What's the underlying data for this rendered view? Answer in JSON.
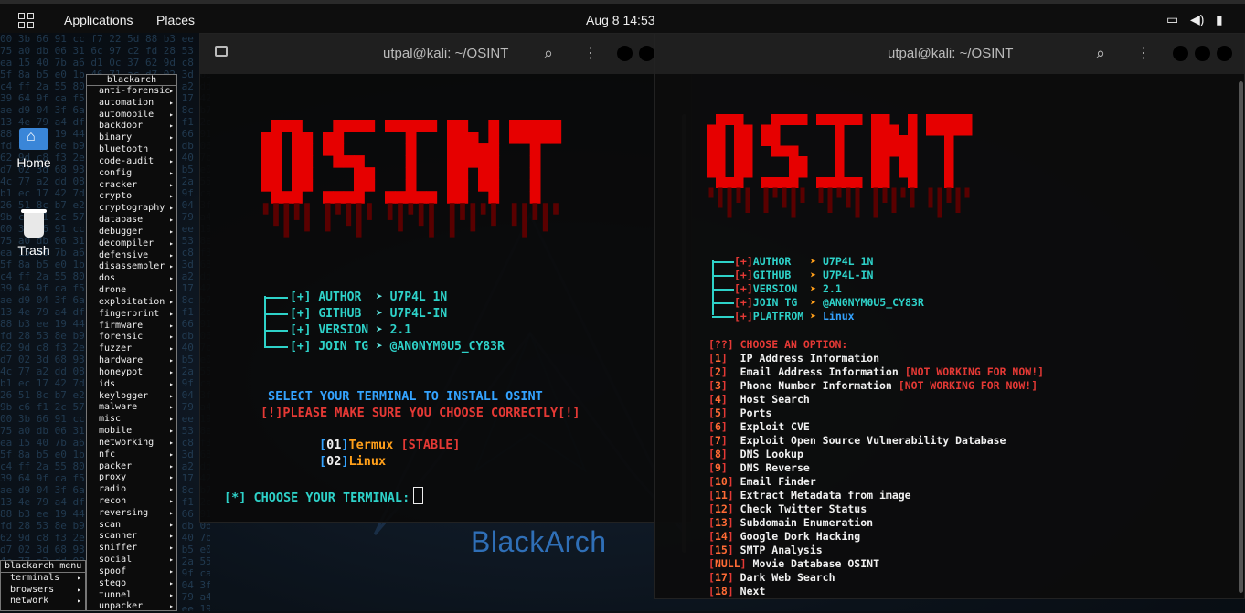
{
  "panel": {
    "applications": "Applications",
    "places": "Places",
    "clock": "Aug 8  14:53"
  },
  "desktop": {
    "home_label": "Home",
    "trash_label": "Trash",
    "watermark": "BlackArch"
  },
  "blackarch_menu": {
    "header": "blackarch",
    "items": [
      "anti-forensic",
      "automation",
      "automobile",
      "backdoor",
      "binary",
      "bluetooth",
      "code-audit",
      "config",
      "cracker",
      "crypto",
      "cryptography",
      "database",
      "debugger",
      "decompiler",
      "defensive",
      "disassembler",
      "dos",
      "drone",
      "exploitation",
      "fingerprint",
      "firmware",
      "forensic",
      "fuzzer",
      "hardware",
      "honeypot",
      "ids",
      "keylogger",
      "malware",
      "misc",
      "mobile",
      "networking",
      "nfc",
      "packer",
      "proxy",
      "radio",
      "recon",
      "reversing",
      "scan",
      "scanner",
      "sniffer",
      "social",
      "spoof",
      "stego",
      "tunnel",
      "unpacker"
    ]
  },
  "blackarch_root_menu": {
    "header": "blackarch menu",
    "items": [
      "terminals",
      "browsers",
      "network"
    ]
  },
  "terminal1": {
    "title": "utpal@kali: ~/OSINT",
    "logo": "OSINT",
    "info": [
      {
        "tag": "[+]",
        "key": "AUTHOR",
        "val": "U7P4L 1N"
      },
      {
        "tag": "[+]",
        "key": "GITHUB",
        "val": "U7P4L-IN"
      },
      {
        "tag": "[+]",
        "key": "VERSION",
        "val": "2.1"
      },
      {
        "tag": "[+]",
        "key": "JOIN TG",
        "val": "@AN0NYM0U5_CY83R"
      }
    ],
    "arrow": "➤",
    "select_text": "SELECT YOUR TERMINAL TO INSTALL OSINT",
    "warning": "[!]PLEASE MAKE SURE YOU CHOOSE CORRECTLY[!]",
    "options": [
      {
        "num": "01",
        "name": "Termux",
        "note": "[STABLE]"
      },
      {
        "num": "02",
        "name": "Linux",
        "note": ""
      }
    ],
    "prompt": "[*] CHOOSE YOUR TERMINAL:"
  },
  "terminal2": {
    "title": "utpal@kali: ~/OSINT",
    "logo": "OSINT",
    "info": [
      {
        "tag": "[+]",
        "key": "AUTHOR",
        "val": "U7P4L 1N"
      },
      {
        "tag": "[+]",
        "key": "GITHUB",
        "val": "U7P4L-IN"
      },
      {
        "tag": "[+]",
        "key": "VERSION",
        "val": "2.1"
      },
      {
        "tag": "[+]",
        "key": "JOIN TG",
        "val": "@AN0NYM0U5_CY83R"
      },
      {
        "tag": "[+]",
        "key": "PLATFROM",
        "val": "Linux"
      }
    ],
    "arrow": "➤",
    "choose": "[??] CHOOSE AN OPTION:",
    "options": [
      {
        "num": "1",
        "label": "IP Address Information",
        "note": ""
      },
      {
        "num": "2",
        "label": "Email Address Information",
        "note": "NOT WORKING FOR NOW!"
      },
      {
        "num": "3",
        "label": "Phone Number Information",
        "note": "NOT WORKING FOR NOW!"
      },
      {
        "num": "4",
        "label": "Host Search",
        "note": ""
      },
      {
        "num": "5",
        "label": "Ports",
        "note": ""
      },
      {
        "num": "6",
        "label": "Exploit CVE",
        "note": ""
      },
      {
        "num": "7",
        "label": "Exploit Open Source Vulnerability Database",
        "note": ""
      },
      {
        "num": "8",
        "label": "DNS Lookup",
        "note": ""
      },
      {
        "num": "9",
        "label": "DNS Reverse",
        "note": ""
      },
      {
        "num": "10",
        "label": "Email Finder",
        "note": ""
      },
      {
        "num": "11",
        "label": "Extract Metadata from image",
        "note": ""
      },
      {
        "num": "12",
        "label": "Check Twitter Status",
        "note": ""
      },
      {
        "num": "13",
        "label": "Subdomain Enumeration",
        "note": ""
      },
      {
        "num": "14",
        "label": "Google Dork Hacking",
        "note": ""
      },
      {
        "num": "15",
        "label": "SMTP Analysis",
        "note": ""
      },
      {
        "num": "NULL",
        "label": "Movie Database OSINT",
        "note": ""
      },
      {
        "num": "17",
        "label": "Dark Web Search",
        "note": ""
      },
      {
        "num": "18",
        "label": "Next",
        "note": ""
      }
    ]
  },
  "colors": {
    "accent_cyan": "#2ed2c9",
    "logo_red": "#e60000",
    "warning_red": "#e53935",
    "option_orange": "#ff9f1a",
    "select_blue": "#34a3ff"
  }
}
